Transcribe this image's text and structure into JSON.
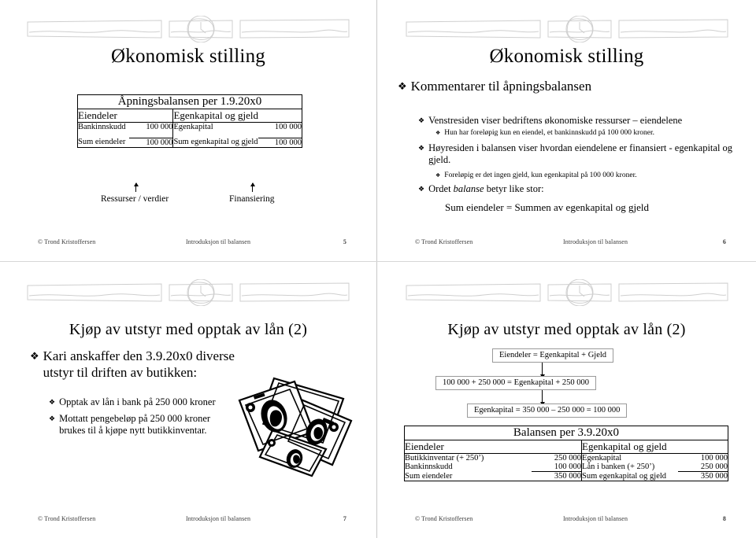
{
  "document": {
    "type": "lecture-handout",
    "slides_per_page": 4
  },
  "footer": {
    "copyright": "© Trond Kristoffersen",
    "subject": "Introduksjon til balansen"
  },
  "slide5": {
    "number": "5",
    "title": "Økonomisk stilling",
    "table": {
      "caption": "Åpningsbalansen per 1.9.20x0",
      "head_left": "Eiendeler",
      "head_right": "Egenkapital og gjeld",
      "rows": [
        {
          "left_label": "Bankinnskudd",
          "left_value": "100 000",
          "right_label": "Egenkapital",
          "right_value": "100 000"
        }
      ],
      "sum_row": {
        "left_label": "Sum eiendeler",
        "left_value": "100 000",
        "right_label": "Sum egenkapital og gjeld",
        "right_value": "100 000"
      }
    },
    "annotations": {
      "left": "Ressurser / verdier",
      "right": "Finansiering"
    }
  },
  "slide6": {
    "number": "6",
    "title": "Økonomisk stilling",
    "bullets": {
      "heading": "Kommentarer til åpningsbalansen",
      "item1": "Venstresiden viser bedriftens økonomiske ressurser – eiendelene",
      "item1_sub": "Hun har foreløpig kun en eiendel, et bankinnskudd på 100 000 kroner.",
      "item2": "Høyresiden i balansen viser hvordan eiendelene er finansiert - egenkapital og gjeld.",
      "item2_sub": "Foreløpig er det ingen gjeld, kun egenkapital på 100 000 kroner.",
      "item3_pre": "Ordet ",
      "item3_em": "balanse",
      "item3_post": " betyr like stor:",
      "equation": "Sum eiendeler  =  Summen av egenkapital og gjeld"
    }
  },
  "slide7": {
    "number": "7",
    "title": "Kjøp av utstyr med opptak av lån (2)",
    "bullets": {
      "lead_line1": "Kari anskaffer den 3.9.20x0 diverse",
      "lead_line2": "utstyr til driften av butikken:",
      "sub1": "Opptak av lån i bank på 250 000 kroner",
      "sub2_line1": "Mottatt pengebeløp på 250 000 kroner",
      "sub2_line2": "brukes til å kjøpe nytt butikkinventar."
    },
    "image_alt": "money-bills-clipart"
  },
  "slide8": {
    "number": "8",
    "title": "Kjøp av utstyr med opptak av lån (2)",
    "flow": [
      "Eiendeler = Egenkapital + Gjeld",
      "100 000 + 250 000  = Egenkapital + 250 000",
      "Egenkapital = 350 000 – 250 000 = 100 000"
    ],
    "table": {
      "caption": "Balansen per 3.9.20x0",
      "head_left": "Eiendeler",
      "head_right": "Egenkapital og gjeld",
      "rows": [
        {
          "left_label": "Butikkinventar (+ 250’)",
          "left_value": "250 000",
          "right_label": "Egenkapital",
          "right_value": "100 000"
        },
        {
          "left_label": "Bankinnskudd",
          "left_value": "100 000",
          "right_label": "Lån i banken (+ 250’)",
          "right_value": "250 000"
        }
      ],
      "sum_row": {
        "left_label": "Sum eiendeler",
        "left_value": "350 000",
        "right_label": "Sum egenkapital og gjeld",
        "right_value": "350 000"
      }
    }
  },
  "icons": {
    "bullet_diamond": "❖",
    "banner": "pencil-banner-graphic"
  },
  "colors": {
    "text": "#000000",
    "divider": "#c8c8c8",
    "banner_stroke": "#cfcfcf",
    "box_border": "#9a9a9a"
  }
}
